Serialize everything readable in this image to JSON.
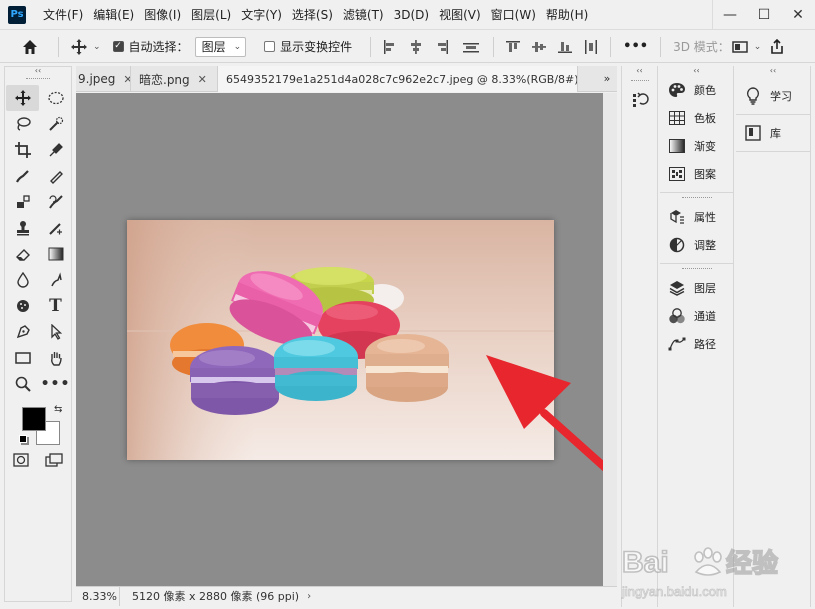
{
  "menubar": {
    "logo": "Ps",
    "items": [
      "文件(F)",
      "编辑(E)",
      "图像(I)",
      "图层(L)",
      "文字(Y)",
      "选择(S)",
      "滤镜(T)",
      "3D(D)",
      "视图(V)",
      "窗口(W)",
      "帮助(H)"
    ],
    "window_buttons": [
      "—",
      "☐",
      "✕"
    ]
  },
  "options": {
    "auto_select_label": "自动选择：",
    "auto_select_value": "图层",
    "show_transform_label": "显示变换控件",
    "mode3d_label": "3D 模式：",
    "more_label": "•••"
  },
  "tabs": [
    {
      "label": "9.jpeg",
      "close": "✕",
      "active": false
    },
    {
      "label": "暗恋.png",
      "close": "✕",
      "active": false
    },
    {
      "label": "6549352179e1a251d4a028c7c962e2c7.jpeg @ 8.33%(RGB/8#)",
      "close": "✕",
      "active": true
    }
  ],
  "tab_overflow": "»",
  "status": {
    "zoom": "8.33%",
    "doc_info": "5120 像素 x 2880 像素 (96 ppi)",
    "arrow": "›"
  },
  "panels": {
    "col1_group1": [
      "颜色",
      "色板",
      "渐变",
      "图案"
    ],
    "col1_group2": [
      "属性",
      "调整"
    ],
    "col1_group3": [
      "图层",
      "通道",
      "路径"
    ],
    "col2": [
      "学习",
      "库"
    ]
  },
  "watermark": {
    "brand": "Bai",
    "brand2": "经验",
    "url": "jingyan.baidu.com"
  },
  "colors": {
    "canvas_bg": "#8c8c8c",
    "arrow_red": "#e8262d",
    "foreground": "#000000",
    "background": "#ffffff"
  }
}
